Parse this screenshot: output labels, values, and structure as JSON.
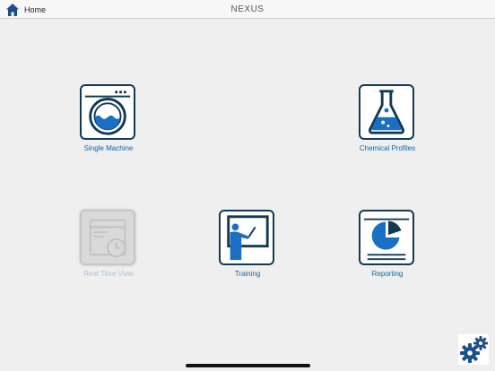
{
  "header": {
    "home_label": "Home",
    "title": "NEXUS"
  },
  "tiles": [
    {
      "label": "Single Machine",
      "icon": "washing-machine-icon",
      "enabled": true
    },
    {
      "label": "Chemical Profiles",
      "icon": "flask-icon",
      "enabled": true
    },
    {
      "label": "Real Time View",
      "icon": "clock-window-icon",
      "enabled": false
    },
    {
      "label": "Training",
      "icon": "presenter-board-icon",
      "enabled": true
    },
    {
      "label": "Reporting",
      "icon": "pie-chart-report-icon",
      "enabled": true
    }
  ],
  "settings": {
    "icon": "gears-icon"
  },
  "colors": {
    "accent": "#0a66a8",
    "icon_dark": "#123a52",
    "icon_blue": "#1a6fc4",
    "disabled": "#c6c6c6"
  }
}
